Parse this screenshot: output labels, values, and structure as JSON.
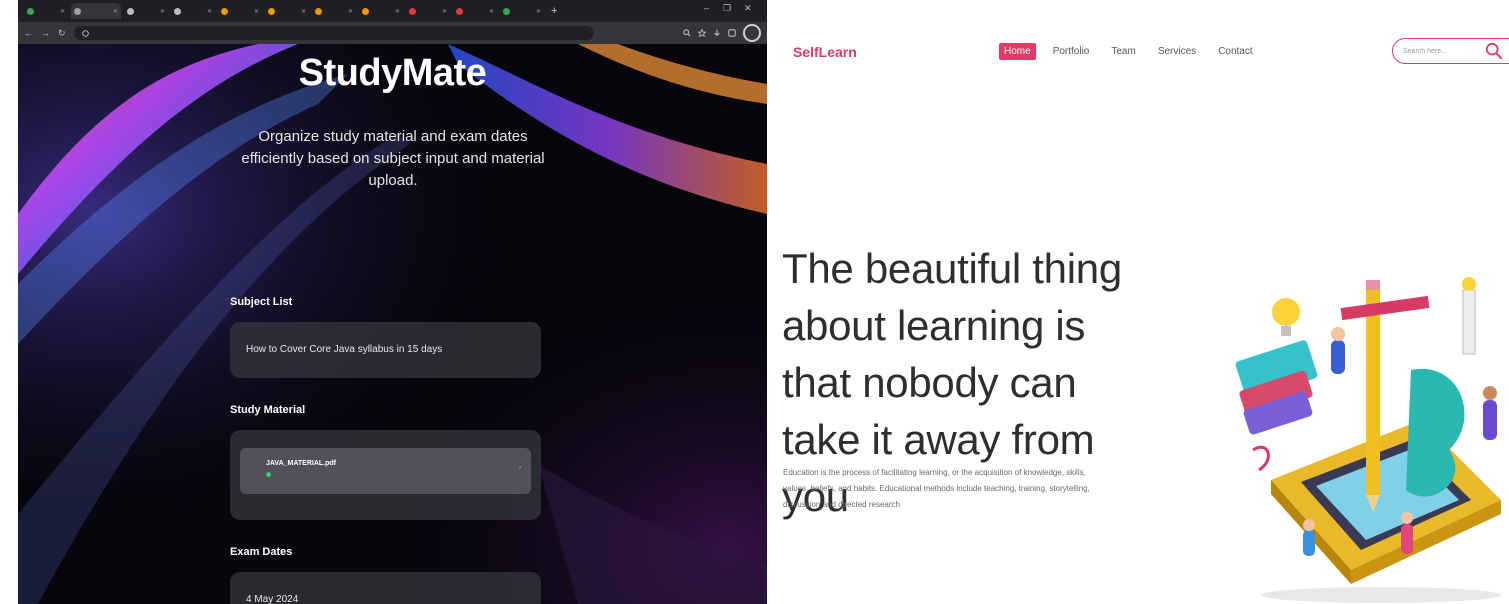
{
  "left": {
    "browser": {
      "tabs": [
        {
          "label": "",
          "color": "#34a853"
        },
        {
          "label": "",
          "color": "#9aa0a6"
        },
        {
          "label": "",
          "color": "#bdbdbd"
        },
        {
          "label": "",
          "color": "#bdbdbd"
        },
        {
          "label": "",
          "color": "#f29900"
        },
        {
          "label": "",
          "color": "#f29900"
        },
        {
          "label": "",
          "color": "#f29900"
        },
        {
          "label": "",
          "color": "#f29900"
        },
        {
          "label": "",
          "color": "#e53935"
        },
        {
          "label": "",
          "color": "#e53935"
        },
        {
          "label": "",
          "color": "#34a853"
        }
      ],
      "new_tab": "+",
      "min": "–",
      "restore": "❐",
      "close": "✕",
      "back": "←",
      "forward": "→",
      "reload": "↻",
      "url": ""
    },
    "app": {
      "title": "StudyMate",
      "description": "Organize study material and exam dates efficiently based on subject input and material upload.",
      "subject_label": "Subject List",
      "subject_value": "How to Cover Core Java syllabus in 15 days",
      "material_label": "Study Material",
      "material_file_name": "JAVA_MATERIAL.pdf",
      "material_file_status": "",
      "exam_label": "Exam Dates",
      "exam_value": "4 May 2024"
    }
  },
  "right": {
    "brand": "SelfLearn",
    "nav": [
      "Home",
      "Portfolio",
      "Team",
      "Services",
      "Contact"
    ],
    "search_placeholder": "Search here...",
    "hero_heading": "The beautiful thing about learning is that nobody can take it away from you",
    "hero_text": "Education is the process of facilitating learning, or the acquisition of knowledge, skills, values, beliefs, and habits. Educational methods include teaching, training, storytelling, discussion and directed research",
    "accent_color": "#e23a64"
  }
}
